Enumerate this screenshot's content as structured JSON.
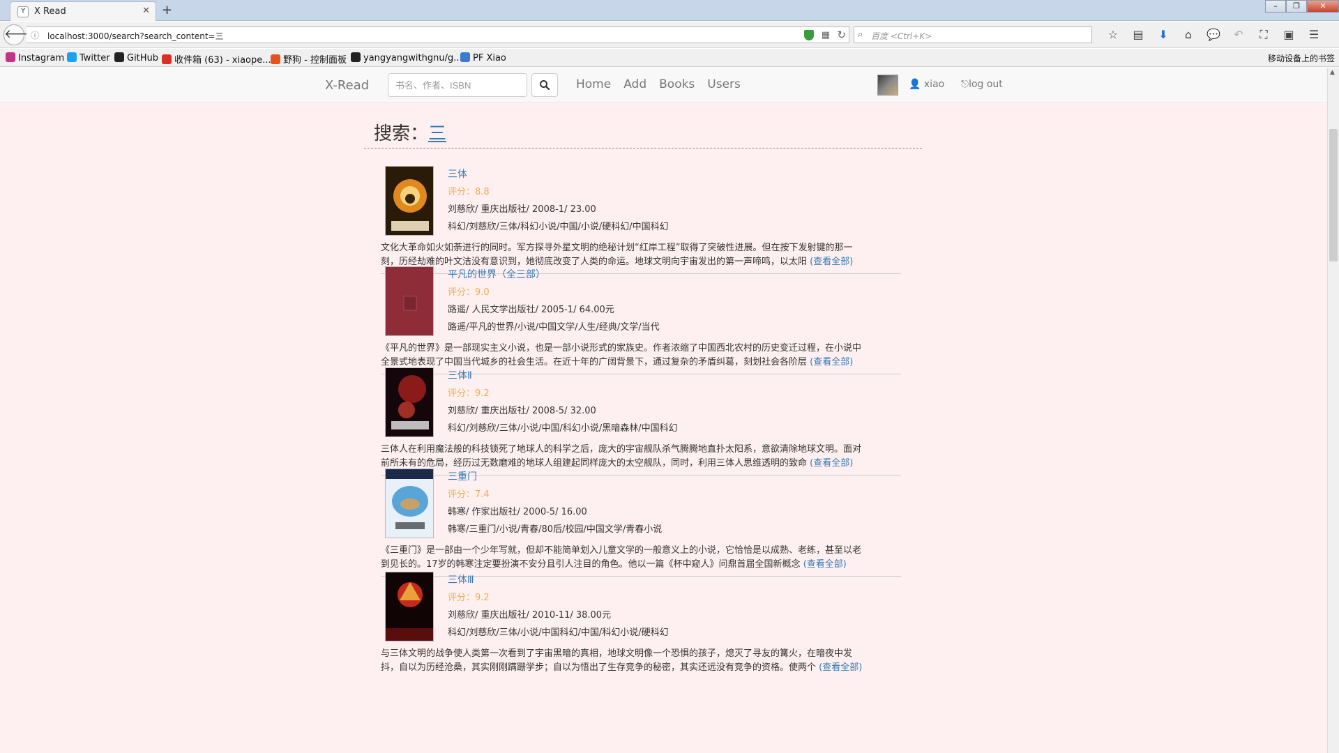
{
  "browser": {
    "tab_title": "X Read",
    "url": "localhost:3000/search?search_content=三",
    "search_placeholder": "百度 <Ctrl+K>",
    "bookmarks": [
      {
        "label": "Instagram",
        "color": "#c13584"
      },
      {
        "label": "Twitter",
        "color": "#1da1f2"
      },
      {
        "label": "GitHub",
        "color": "#222222"
      },
      {
        "label": "收件箱 (63) - xiaope...",
        "color": "#d93025"
      },
      {
        "label": "野狗 - 控制面板",
        "color": "#e8501e"
      },
      {
        "label": "yangyangwithgnu/g...",
        "color": "#222222"
      },
      {
        "label": "PF Xiao",
        "color": "#3a7bd5"
      }
    ],
    "bookmarks_right": "移动设备上的书签"
  },
  "site": {
    "brand": "X-Read",
    "search_placeholder": "书名、作者、ISBN",
    "nav": [
      "Home",
      "Add",
      "Books",
      "Users"
    ],
    "username": "xiao",
    "logout": "log out"
  },
  "search": {
    "label": "搜索：",
    "query": "三"
  },
  "more_label": "(查看全部)",
  "books": [
    {
      "title": "三体",
      "rating": "评分：8.8",
      "pub": "刘慈欣/ 重庆出版社/ 2008-1/ 23.00",
      "tags": "科幻/刘慈欣/三体/科幻小说/中国/小说/硬科幻/中国科幻",
      "desc1": "文化大革命如火如荼进行的同时。军方探寻外星文明的绝秘计划“红岸工程”取得了突破性进展。但在按下发射键的那一",
      "desc2": "刻，历经劫难的叶文洁没有意识到，她彻底改变了人类的命运。地球文明向宇宙发出的第一声啼鸣，以太阳",
      "cover": "santi1"
    },
    {
      "title": "平凡的世界（全三部）",
      "rating": "评分：9.0",
      "pub": "路遥/ 人民文学出版社/ 2005-1/ 64.00元",
      "tags": "路遥/平凡的世界/小说/中国文学/人生/经典/文学/当代",
      "desc1": "《平凡的世界》是一部现实主义小说，也是一部小说形式的家族史。作者浓缩了中国西北农村的历史变迁过程，在小说中",
      "desc2": "全景式地表现了中国当代城乡的社会生活。在近十年的广阔背景下，通过复杂的矛盾纠葛，刻划社会各阶层",
      "cover": "pingfan"
    },
    {
      "title": "三体Ⅱ",
      "rating": "评分：9.2",
      "pub": "刘慈欣/ 重庆出版社/ 2008-5/ 32.00",
      "tags": "科幻/刘慈欣/三体/小说/中国/科幻小说/黑暗森林/中国科幻",
      "desc1": "三体人在利用魔法般的科技锁死了地球人的科学之后，庞大的宇宙舰队杀气腾腾地直扑太阳系，意欲清除地球文明。面对",
      "desc2": "前所未有的危局，经历过无数磨难的地球人组建起同样庞大的太空舰队，同时，利用三体人思维透明的致命",
      "cover": "santi2"
    },
    {
      "title": "三重门",
      "rating": "评分：7.4",
      "pub": "韩寒/ 作家出版社/ 2000-5/ 16.00",
      "tags": "韩寒/三重门/小说/青春/80后/校园/中国文学/青春小说",
      "desc1": "《三重门》是一部由一个少年写就，但却不能简单划入儿童文学的一般意义上的小说，它恰恰是以成熟、老练，甚至以老",
      "desc2": "到见长的。17岁的韩寒注定要扮演不安分且引人注目的角色。他以一篇《杯中窥人》问鼎首届全国新概念",
      "cover": "sanchongmen"
    },
    {
      "title": "三体Ⅲ",
      "rating": "评分：9.2",
      "pub": "刘慈欣/ 重庆出版社/ 2010-11/ 38.00元",
      "tags": "科幻/刘慈欣/三体/小说/中国科幻/中国/科幻小说/硬科幻",
      "desc1": "与三体文明的战争使人类第一次看到了宇宙黑暗的真相，地球文明像一个恐惧的孩子，熄灭了寻友的篝火，在暗夜中发",
      "desc2": "抖，自以为历经沧桑，其实刚刚蹒跚学步；自以为悟出了生存竞争的秘密，其实还远没有竞争的资格。使两个",
      "cover": "santi3"
    }
  ]
}
